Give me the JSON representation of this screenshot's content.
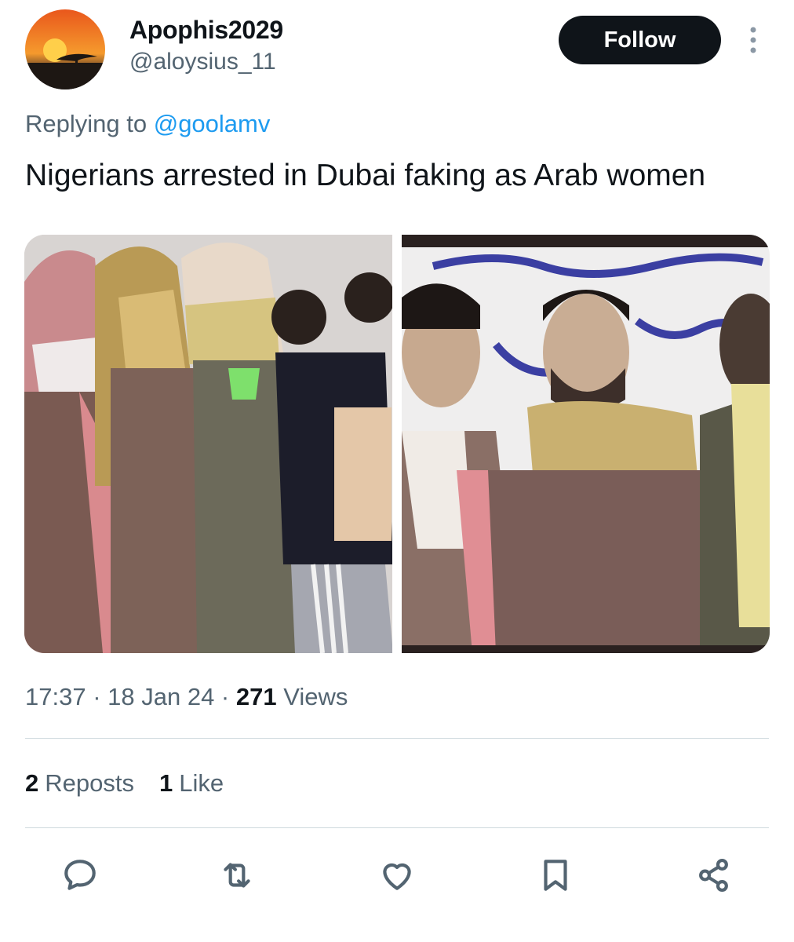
{
  "author": {
    "display_name": "Apophis2029",
    "handle": "@aloysius_11",
    "avatar_icon": "sunset-acacia-avatar"
  },
  "header": {
    "follow_label": "Follow",
    "more_icon": "vertical-ellipsis-icon"
  },
  "reply": {
    "prefix": "Replying to ",
    "mention": "@goolamv"
  },
  "tweet": {
    "text": "Nigerians arrested in Dubai faking as Arab women"
  },
  "media": {
    "count": 2
  },
  "meta": {
    "time": "17:37",
    "sep1": " · ",
    "date": "18 Jan 24",
    "sep2": " · ",
    "views_count": "271",
    "views_label": " Views"
  },
  "stats": {
    "reposts_count": "2",
    "reposts_label": "Reposts",
    "likes_count": "1",
    "likes_label": "Like"
  },
  "actions": [
    {
      "icon": "reply-bubble-icon"
    },
    {
      "icon": "repost-icon"
    },
    {
      "icon": "heart-icon"
    },
    {
      "icon": "bookmark-icon"
    },
    {
      "icon": "share-icon"
    }
  ],
  "colors": {
    "text_primary": "#0f1419",
    "text_secondary": "#536471",
    "link": "#1d9bf0",
    "divider": "#cfd9de",
    "follow_bg": "#0f1419"
  }
}
